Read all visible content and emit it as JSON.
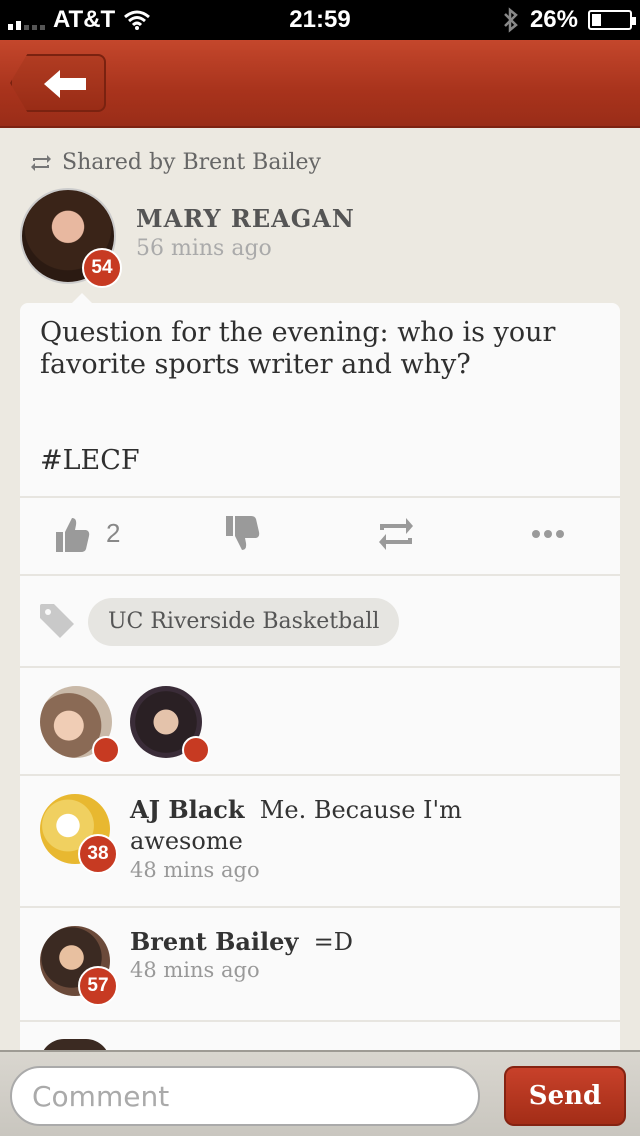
{
  "status_bar": {
    "carrier": "AT&T",
    "time": "21:59",
    "battery_percent_label": "26%",
    "battery_level": 0.26
  },
  "nav": {
    "back_icon": "left-arrow-icon"
  },
  "shared_by": {
    "icon": "repost-icon",
    "text": "Shared by Brent Bailey"
  },
  "author": {
    "name": "MARY REAGAN",
    "time": "56 mins ago",
    "badge": "54"
  },
  "post": {
    "text": "Question for the evening: who is your favorite sports writer and why?",
    "hashtag": "#LECF"
  },
  "actions": {
    "like_count": "2"
  },
  "tags": [
    "UC Riverside Basketball"
  ],
  "comments": [
    {
      "name": "AJ Black",
      "text": "Me. Because I'm awesome",
      "time": "48 mins ago",
      "badge": "38"
    },
    {
      "name": "Brent Bailey",
      "text": "=D",
      "time": "48 mins ago",
      "badge": "57"
    }
  ],
  "comment_bar": {
    "placeholder": "Comment",
    "send_label": "Send"
  },
  "colors": {
    "accent": "#c73a22",
    "background": "#ece9e1",
    "card": "#fafafa"
  }
}
